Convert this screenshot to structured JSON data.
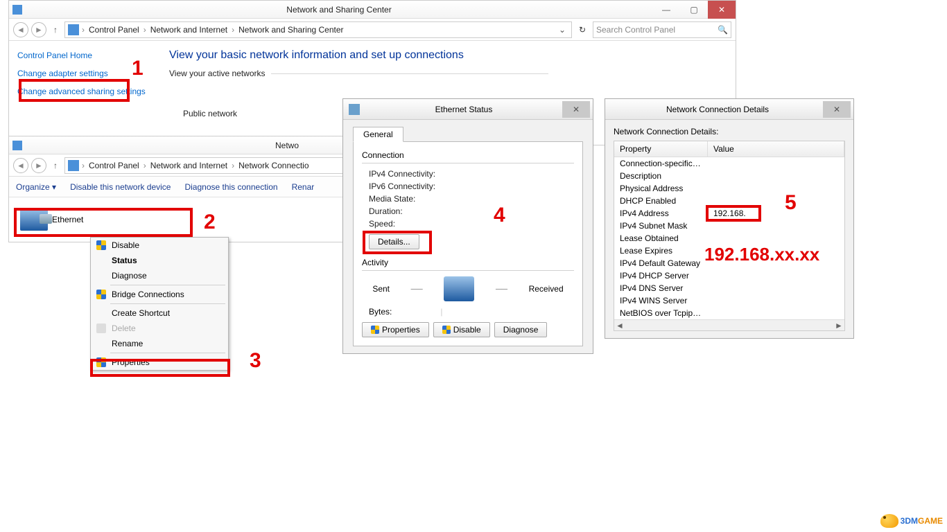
{
  "main_window": {
    "title": "Network and Sharing Center",
    "breadcrumb": {
      "root_icon": "control-panel-icon",
      "items": [
        "Control Panel",
        "Network and Internet",
        "Network and Sharing Center"
      ]
    },
    "search_placeholder": "Search Control Panel",
    "sidebar": {
      "home": "Control Panel Home",
      "change_adapter": "Change adapter settings",
      "change_advanced": "Change advanced sharing settings"
    },
    "content": {
      "heading": "View your basic network information and set up connections",
      "active_networks_label": "View your active networks",
      "public_network_label": "Public network"
    }
  },
  "conn_window": {
    "title": "Netwo",
    "breadcrumb": {
      "items": [
        "Control Panel",
        "Network and Internet",
        "Network Connectio"
      ]
    },
    "toolbar": {
      "organize": "Organize ▾",
      "disable": "Disable this network device",
      "diagnose": "Diagnose this connection",
      "rename": "Renar"
    },
    "adapter_name": "Ethernet"
  },
  "context_menu": {
    "disable": "Disable",
    "status": "Status",
    "diagnose": "Diagnose",
    "bridge": "Bridge Connections",
    "shortcut": "Create Shortcut",
    "delete": "Delete",
    "rename": "Rename",
    "properties": "Properties"
  },
  "status_dialog": {
    "title": "Ethernet Status",
    "tab_general": "General",
    "group_connection": "Connection",
    "ipv4_conn": "IPv4 Connectivity:",
    "ipv6_conn": "IPv6 Connectivity:",
    "media_state": "Media State:",
    "duration": "Duration:",
    "speed": "Speed:",
    "details_btn": "Details...",
    "group_activity": "Activity",
    "sent": "Sent",
    "received": "Received",
    "bytes": "Bytes:",
    "properties_btn": "Properties",
    "disable_btn": "Disable",
    "diagnose_btn": "Diagnose"
  },
  "details_dialog": {
    "title": "Network Connection Details",
    "subtitle": "Network Connection Details:",
    "header_prop": "Property",
    "header_val": "Value",
    "rows": [
      {
        "prop": "Connection-specific DN...",
        "val": ""
      },
      {
        "prop": "Description",
        "val": ""
      },
      {
        "prop": "Physical Address",
        "val": ""
      },
      {
        "prop": "DHCP Enabled",
        "val": ""
      },
      {
        "prop": "IPv4 Address",
        "val": "192.168."
      },
      {
        "prop": "IPv4 Subnet Mask",
        "val": ""
      },
      {
        "prop": "Lease Obtained",
        "val": ""
      },
      {
        "prop": "Lease Expires",
        "val": ""
      },
      {
        "prop": "IPv4 Default Gateway",
        "val": ""
      },
      {
        "prop": "IPv4 DHCP Server",
        "val": ""
      },
      {
        "prop": "IPv4 DNS Server",
        "val": ""
      },
      {
        "prop": "IPv4 WINS Server",
        "val": ""
      },
      {
        "prop": "NetBIOS over Tcpip En...",
        "val": ""
      }
    ]
  },
  "annotations": {
    "n1": "1",
    "n2": "2",
    "n3": "3",
    "n4": "4",
    "n5": "5",
    "ip_example": "192.168.xx.xx"
  },
  "watermark": {
    "a": "3DM",
    "b": "GAME"
  }
}
